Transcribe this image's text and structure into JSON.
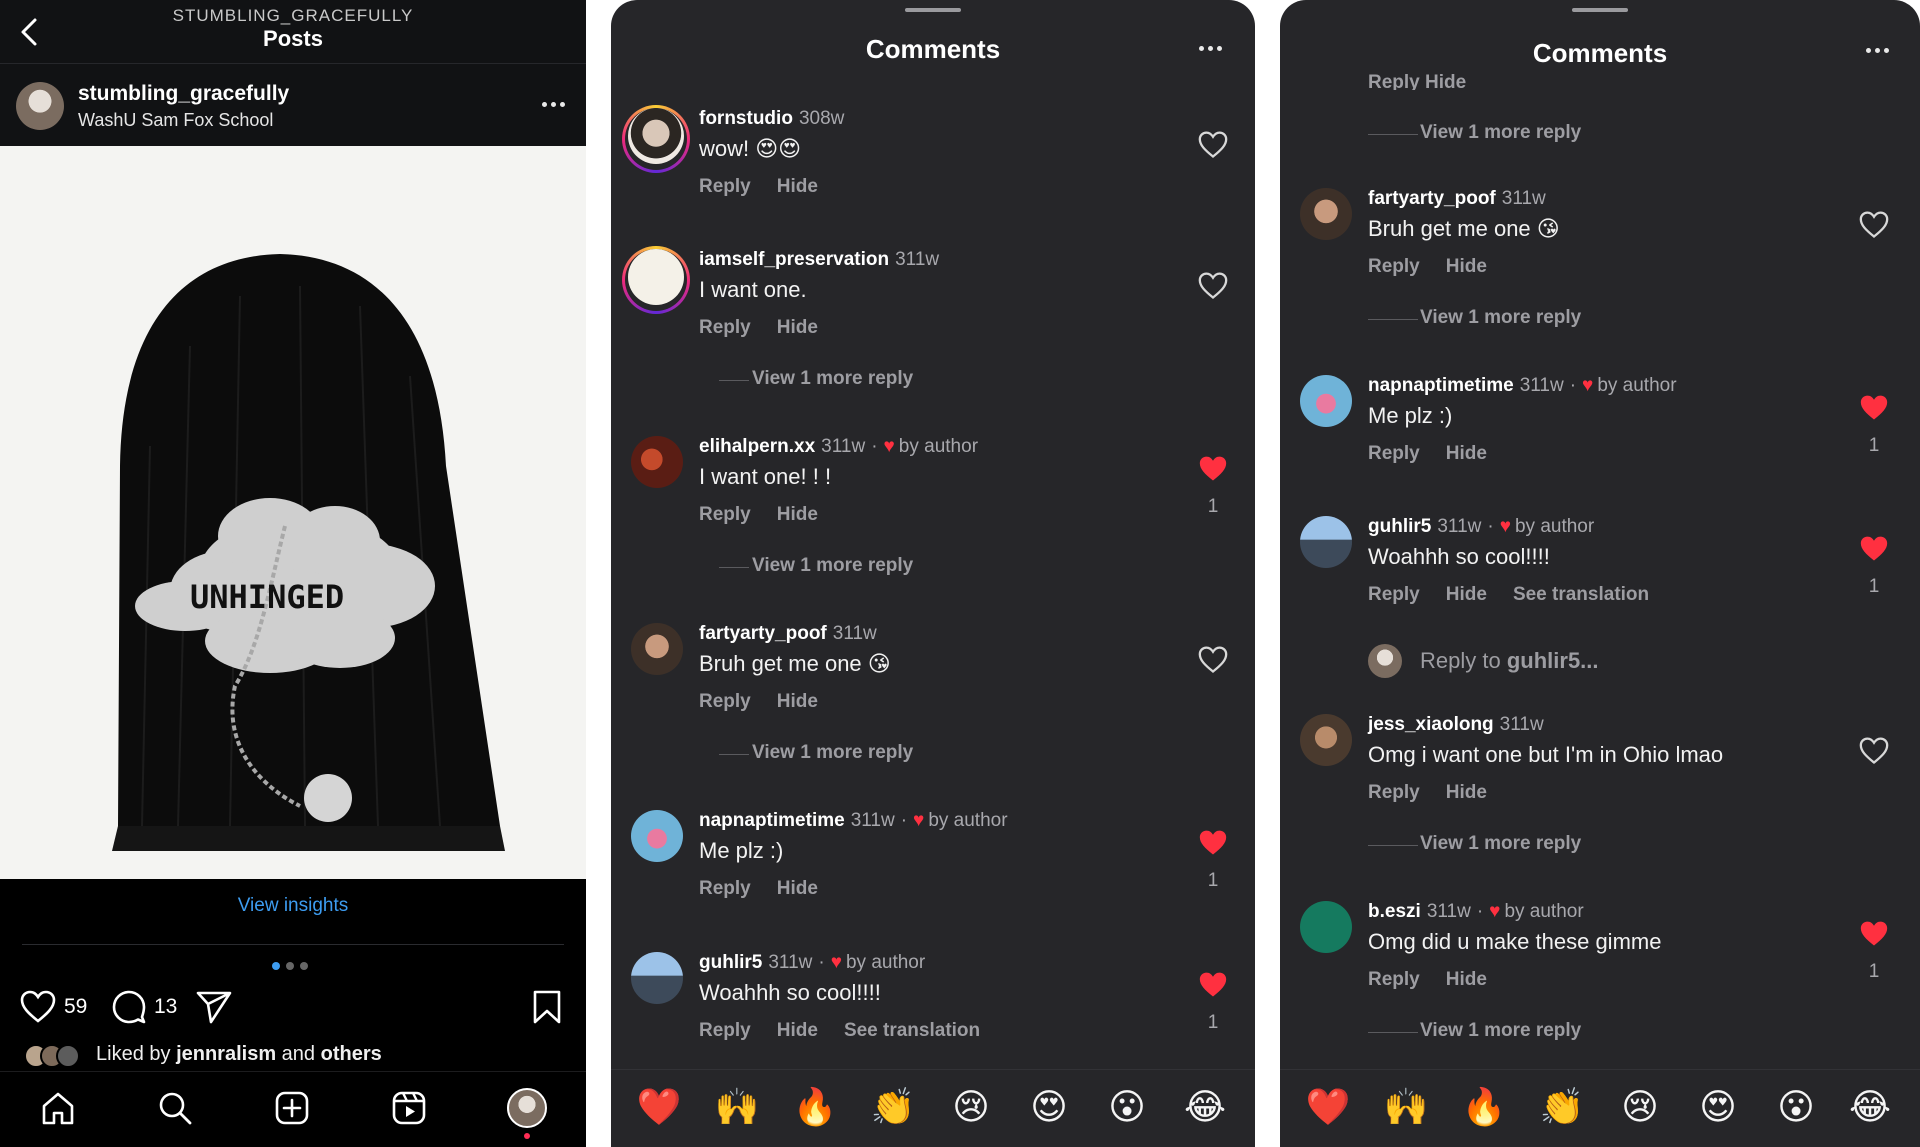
{
  "post_screen": {
    "account_caps": "STUMBLING_GRACEFULLY",
    "title": "Posts",
    "username": "stumbling_gracefully",
    "subtitle": "WashU Sam Fox School",
    "hat_text": "UNHINGED",
    "view_insights": "View insights",
    "likes": "59",
    "comments": "13",
    "liked_by_prefix": "Liked by",
    "liked_by_user": "jennralism",
    "liked_by_and": "and",
    "liked_by_others": "others",
    "icons": {
      "back": "chevron-left-icon",
      "more": "more-dots-icon",
      "like": "heart-outline-icon",
      "comment": "comment-bubble-icon",
      "share": "paper-plane-icon",
      "save": "bookmark-icon",
      "home": "home-icon",
      "search": "search-icon",
      "create": "plus-square-icon",
      "reels": "reels-icon",
      "profile": "profile-avatar"
    }
  },
  "comments_a": {
    "title": "Comments",
    "items": [
      {
        "user": "fornstudio",
        "time": "308w",
        "text": "wow! 😍😍",
        "reply": "Reply",
        "hide": "Hide",
        "liked": false,
        "likes": ""
      },
      {
        "user": "iamself_preservation",
        "time": "311w",
        "text": "I want one.",
        "reply": "Reply",
        "hide": "Hide",
        "liked": false,
        "likes": "",
        "more": "View 1 more reply"
      },
      {
        "user": "elihalpern.xx",
        "time": "311w",
        "by": "by author",
        "text": "I want one! ! !",
        "reply": "Reply",
        "hide": "Hide",
        "liked": true,
        "likes": "1",
        "more": "View 1 more reply"
      },
      {
        "user": "fartyarty_poof",
        "time": "311w",
        "text": "Bruh get me one 😘",
        "reply": "Reply",
        "hide": "Hide",
        "liked": false,
        "likes": "",
        "more": "View 1 more reply"
      },
      {
        "user": "napnaptimetime",
        "time": "311w",
        "by": "by author",
        "text": "Me plz :)",
        "reply": "Reply",
        "hide": "Hide",
        "liked": true,
        "likes": "1"
      },
      {
        "user": "guhlir5",
        "time": "311w",
        "by": "by author",
        "text": "Woahhh so cool!!!!",
        "reply": "Reply",
        "hide": "Hide",
        "translate": "See translation",
        "liked": true,
        "likes": "1"
      }
    ],
    "emojis": [
      "❤️",
      "🙌",
      "🔥",
      "👏",
      "😢",
      "😍",
      "😮",
      "😂"
    ]
  },
  "comments_b": {
    "title": "Comments",
    "clipped_actions": "Reply Hide",
    "top_more": "View 1 more reply",
    "items": [
      {
        "user": "fartyarty_poof",
        "time": "311w",
        "text": "Bruh get me one 😘",
        "reply": "Reply",
        "hide": "Hide",
        "liked": false,
        "likes": "",
        "more": "View 1 more reply"
      },
      {
        "user": "napnaptimetime",
        "time": "311w",
        "by": "by author",
        "text": "Me plz :)",
        "reply": "Reply",
        "hide": "Hide",
        "liked": true,
        "likes": "1"
      },
      {
        "user": "guhlir5",
        "time": "311w",
        "by": "by author",
        "text": "Woahhh so cool!!!!",
        "reply": "Reply",
        "hide": "Hide",
        "translate": "See translation",
        "liked": true,
        "likes": "1"
      },
      {
        "user": "jess_xiaolong",
        "time": "311w",
        "text": "Omg i want one but I'm in Ohio lmao",
        "reply": "Reply",
        "hide": "Hide",
        "liked": false,
        "likes": "",
        "more": "View 1 more reply"
      },
      {
        "user": "b.eszi",
        "time": "311w",
        "by": "by author",
        "text": "Omg did u make these gimme",
        "reply": "Reply",
        "hide": "Hide",
        "liked": true,
        "likes": "1",
        "more": "View 1 more reply"
      }
    ],
    "reply_to_prefix": "Reply to",
    "reply_to_user": "guhlir5...",
    "emojis": [
      "❤️",
      "🙌",
      "🔥",
      "👏",
      "😢",
      "😍",
      "😮",
      "😂"
    ]
  },
  "colors": {
    "link_blue": "#3d9cf0",
    "like_red": "#ff3040",
    "panel_bg": "#262629"
  }
}
